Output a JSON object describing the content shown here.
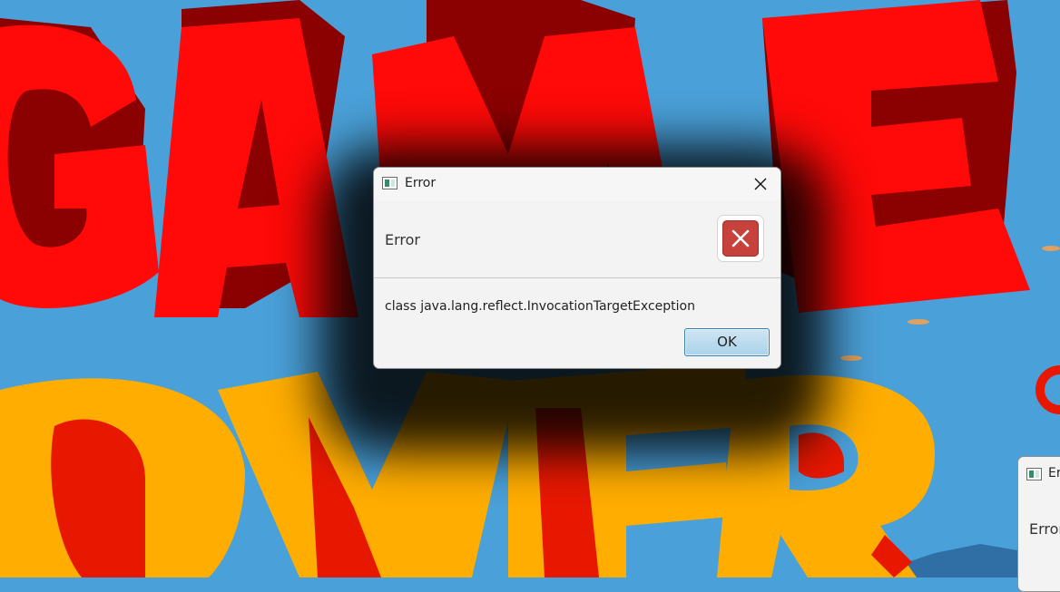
{
  "background": {
    "line1": "GAME",
    "line2": "OVER",
    "colors": {
      "sky": "#4aa0d8",
      "game_red": "#ff0a08",
      "game_shadow": "#8b0000",
      "over_orange": "#ffad00",
      "over_red": "#e81800"
    }
  },
  "dialog": {
    "title": "Error",
    "header": "Error",
    "message": "class java.lang.reflect.InvocationTargetException",
    "ok_label": "OK",
    "close_icon": "close-icon",
    "error_icon": "error-x-icon",
    "colors": {
      "error_icon_bg": "#c7413d",
      "ok_bg": "#b8dcf0",
      "ok_border": "#3c7fb1"
    }
  },
  "dialog2": {
    "title": "Er",
    "header": "Error"
  }
}
